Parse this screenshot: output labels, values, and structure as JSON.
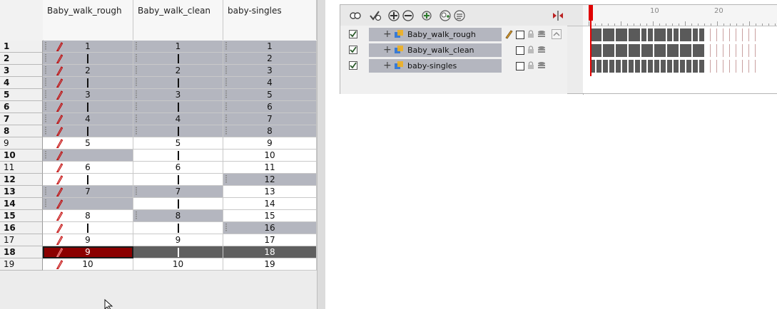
{
  "xsheet": {
    "columns": [
      "Baby_walk_rough",
      "Baby_walk_clean",
      "baby-singles"
    ],
    "rows": [
      {
        "frame": "1",
        "bold": true,
        "c": [
          {
            "v": "1",
            "s": "gray",
            "p": true,
            "d": true
          },
          {
            "v": "1",
            "s": "gray",
            "d": true
          },
          {
            "v": "1",
            "s": "gray",
            "d": true
          }
        ]
      },
      {
        "frame": "2",
        "bold": true,
        "c": [
          {
            "v": "|",
            "s": "gray",
            "p": true,
            "d": true
          },
          {
            "v": "|",
            "s": "gray",
            "d": true
          },
          {
            "v": "2",
            "s": "gray",
            "d": true
          }
        ]
      },
      {
        "frame": "3",
        "bold": true,
        "c": [
          {
            "v": "2",
            "s": "gray",
            "p": true,
            "d": true
          },
          {
            "v": "2",
            "s": "gray",
            "d": true
          },
          {
            "v": "3",
            "s": "gray",
            "d": true
          }
        ]
      },
      {
        "frame": "4",
        "bold": true,
        "c": [
          {
            "v": "|",
            "s": "gray",
            "p": true,
            "d": true
          },
          {
            "v": "|",
            "s": "gray",
            "d": true
          },
          {
            "v": "4",
            "s": "gray",
            "d": true
          }
        ]
      },
      {
        "frame": "5",
        "bold": true,
        "c": [
          {
            "v": "3",
            "s": "gray",
            "p": true,
            "d": true
          },
          {
            "v": "3",
            "s": "gray",
            "d": true
          },
          {
            "v": "5",
            "s": "gray",
            "d": true
          }
        ]
      },
      {
        "frame": "6",
        "bold": true,
        "c": [
          {
            "v": "|",
            "s": "gray",
            "p": true,
            "d": true
          },
          {
            "v": "|",
            "s": "gray",
            "d": true
          },
          {
            "v": "6",
            "s": "gray",
            "d": true
          }
        ]
      },
      {
        "frame": "7",
        "bold": true,
        "c": [
          {
            "v": "4",
            "s": "gray",
            "p": true,
            "d": true
          },
          {
            "v": "4",
            "s": "gray",
            "d": true
          },
          {
            "v": "7",
            "s": "gray",
            "d": true
          }
        ]
      },
      {
        "frame": "8",
        "bold": true,
        "c": [
          {
            "v": "|",
            "s": "gray",
            "p": true,
            "d": true
          },
          {
            "v": "|",
            "s": "gray",
            "d": true
          },
          {
            "v": "8",
            "s": "gray",
            "d": true
          }
        ]
      },
      {
        "frame": "9",
        "bold": false,
        "c": [
          {
            "v": "5",
            "s": "white",
            "p": true
          },
          {
            "v": "5",
            "s": "white"
          },
          {
            "v": "9",
            "s": "white"
          }
        ]
      },
      {
        "frame": "10",
        "bold": true,
        "c": [
          {
            "v": "",
            "s": "gray",
            "p": true,
            "d": true
          },
          {
            "v": "|",
            "s": "white"
          },
          {
            "v": "10",
            "s": "white"
          }
        ]
      },
      {
        "frame": "11",
        "bold": false,
        "c": [
          {
            "v": "6",
            "s": "white",
            "p": true
          },
          {
            "v": "6",
            "s": "white"
          },
          {
            "v": "11",
            "s": "white"
          }
        ]
      },
      {
        "frame": "12",
        "bold": true,
        "c": [
          {
            "v": "|",
            "s": "white",
            "p": true
          },
          {
            "v": "|",
            "s": "white"
          },
          {
            "v": "12",
            "s": "gray",
            "d": true
          }
        ]
      },
      {
        "frame": "13",
        "bold": true,
        "c": [
          {
            "v": "7",
            "s": "gray",
            "p": true,
            "d": true
          },
          {
            "v": "7",
            "s": "gray",
            "d": true
          },
          {
            "v": "13",
            "s": "white"
          }
        ]
      },
      {
        "frame": "14",
        "bold": true,
        "c": [
          {
            "v": "",
            "s": "gray",
            "p": true,
            "d": true
          },
          {
            "v": "|",
            "s": "white"
          },
          {
            "v": "14",
            "s": "white"
          }
        ]
      },
      {
        "frame": "15",
        "bold": true,
        "c": [
          {
            "v": "8",
            "s": "white",
            "p": true
          },
          {
            "v": "8",
            "s": "gray",
            "d": true
          },
          {
            "v": "15",
            "s": "white"
          }
        ]
      },
      {
        "frame": "16",
        "bold": true,
        "c": [
          {
            "v": "|",
            "s": "white",
            "p": true
          },
          {
            "v": "|",
            "s": "white"
          },
          {
            "v": "16",
            "s": "gray",
            "d": true
          }
        ]
      },
      {
        "frame": "17",
        "bold": false,
        "c": [
          {
            "v": "9",
            "s": "white",
            "p": true
          },
          {
            "v": "9",
            "s": "white"
          },
          {
            "v": "17",
            "s": "white"
          }
        ]
      },
      {
        "frame": "18",
        "bold": true,
        "c": [
          {
            "v": "9",
            "s": "red",
            "p": true
          },
          {
            "v": "|",
            "s": "dark"
          },
          {
            "v": "18",
            "s": "dark"
          }
        ]
      },
      {
        "frame": "19",
        "bold": false,
        "c": [
          {
            "v": "10",
            "s": "white",
            "p": true
          },
          {
            "v": "10",
            "s": "white"
          },
          {
            "v": "19",
            "s": "white"
          }
        ]
      }
    ]
  },
  "timeline": {
    "layers": [
      {
        "name": "Baby_walk_rough",
        "checked": true,
        "pen": true
      },
      {
        "name": "Baby_walk_clean",
        "checked": true,
        "pen": false
      },
      {
        "name": "baby-singles",
        "checked": true,
        "pen": false
      }
    ],
    "ruler_labels": [
      "10",
      "20"
    ],
    "toolbar_icons": [
      "onion-skin-icon",
      "onion-skin-layer-icon",
      "add-layer-icon",
      "remove-layer-icon",
      "add-peg-icon",
      "add-drawing-icon",
      "add-group-icon"
    ]
  },
  "colors": {
    "exposed_cell": "#b4b6bf",
    "current_frame_selected": "#8b0000",
    "current_frame": "#5f5f5f",
    "playhead": "#e00000"
  }
}
